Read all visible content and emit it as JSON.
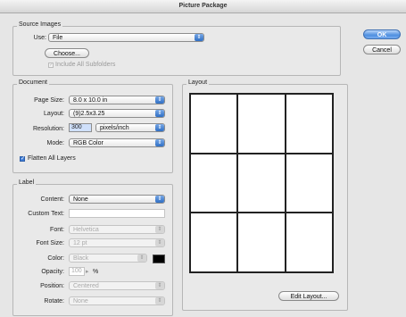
{
  "window": {
    "title": "Picture Package"
  },
  "source": {
    "title": "Source Images",
    "use_label": "Use:",
    "use_value": "File",
    "choose_label": "Choose...",
    "include_subfolders_label": "Include All Subfolders"
  },
  "buttons": {
    "ok": "OK",
    "cancel": "Cancel",
    "edit_layout": "Edit Layout..."
  },
  "document": {
    "title": "Document",
    "page_size_label": "Page Size:",
    "page_size_value": "8.0 x 10.0 in",
    "layout_label": "Layout:",
    "layout_value": "(9)2.5x3.25",
    "resolution_label": "Resolution:",
    "resolution_value": "300",
    "resolution_unit": "pixels/inch",
    "mode_label": "Mode:",
    "mode_value": "RGB Color",
    "flatten_label": "Flatten All Layers"
  },
  "label": {
    "title": "Label",
    "content_label": "Content:",
    "content_value": "None",
    "custom_text_label": "Custom Text:",
    "font_label": "Font:",
    "font_value": "Helvetica",
    "font_size_label": "Font Size:",
    "font_size_value": "12 pt",
    "color_label": "Color:",
    "color_value": "Black",
    "opacity_label": "Opacity:",
    "opacity_value": "100",
    "opacity_unit": "%",
    "position_label": "Position:",
    "position_value": "Centered",
    "rotate_label": "Rotate:",
    "rotate_value": "None"
  },
  "layout_panel": {
    "title": "Layout",
    "grid_rows": 3,
    "grid_cols": 3
  }
}
